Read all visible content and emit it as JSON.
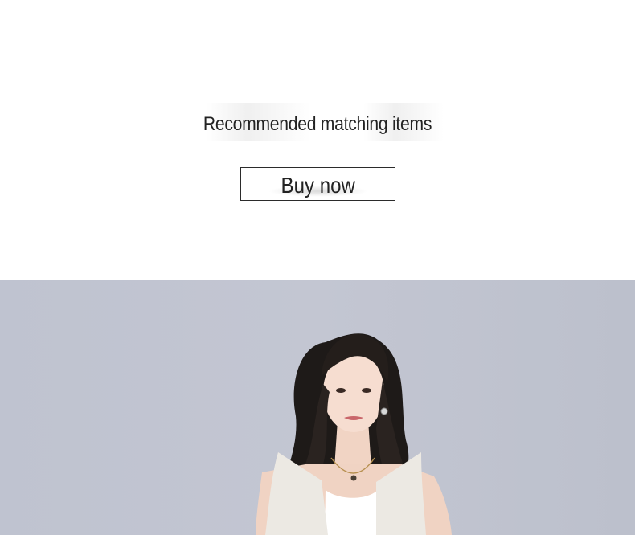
{
  "section": {
    "heading": "Recommended matching items",
    "buy_button_label": "Buy now"
  },
  "colors": {
    "background": "#ffffff",
    "text": "#222222",
    "button_border": "#2b2b2b",
    "photo_background": "#c1c4d0"
  },
  "photo": {
    "subject": "model-portrait-icon"
  }
}
